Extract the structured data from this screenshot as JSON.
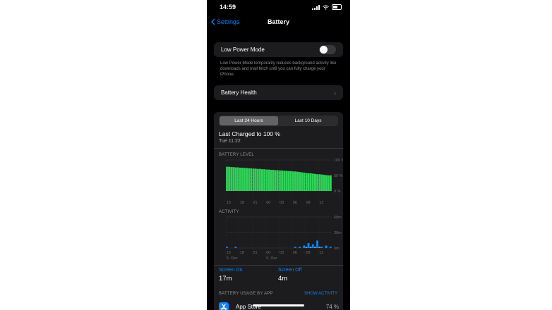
{
  "status_bar": {
    "time": "14:59"
  },
  "nav": {
    "back_label": "Settings",
    "title": "Battery"
  },
  "low_power": {
    "label": "Low Power Mode",
    "enabled": false,
    "description": "Low Power Mode temporarily reduces background activity like downloads and mail fetch until you can fully charge your iPhone."
  },
  "battery_health": {
    "label": "Battery Health"
  },
  "tabs": [
    {
      "label": "Last 24 Hours",
      "active": true
    },
    {
      "label": "Last 10 Days",
      "active": false
    }
  ],
  "last_charged": {
    "title": "Last Charged to 100 %",
    "time": "Tue 11:22"
  },
  "battery_level": {
    "heading": "BATTERY LEVEL",
    "y_ticks": [
      "100 %",
      "50 %",
      "0 %"
    ],
    "x_ticks": [
      "15",
      "18",
      "21",
      "00",
      "03",
      "06",
      "09",
      "12"
    ],
    "levels": [
      78,
      78,
      77,
      77,
      76,
      76,
      75,
      75,
      74,
      74,
      73,
      73,
      72,
      72,
      71,
      71,
      70,
      70,
      69,
      69,
      68,
      68,
      67,
      67,
      66,
      66,
      65,
      65,
      64,
      64,
      63,
      63,
      62,
      61,
      60,
      59,
      58,
      57,
      57,
      56,
      55,
      54,
      54,
      53,
      52,
      51,
      50,
      50
    ]
  },
  "activity": {
    "heading": "ACTIVITY",
    "y_ticks": [
      "60m",
      "30m",
      "0m"
    ],
    "x_ticks": [
      "15",
      "18",
      "21",
      "00",
      "03",
      "06",
      "09",
      "12"
    ],
    "date_labels": [
      "5. Dec",
      "6. Dec"
    ],
    "screen_on_minutes": [
      1,
      0,
      0,
      0,
      1,
      0,
      0,
      0,
      0,
      0,
      0,
      0,
      0,
      0,
      0,
      0,
      0,
      0,
      0,
      0,
      0,
      0,
      0,
      0,
      0,
      0,
      0,
      0,
      0,
      0,
      0,
      1,
      0,
      1,
      0,
      2,
      0,
      4,
      0,
      3,
      0,
      6,
      0,
      1,
      0,
      2,
      0,
      1
    ],
    "screen_off_minutes": [
      0,
      0,
      0,
      0,
      0,
      0,
      0,
      0,
      0,
      0,
      0,
      0,
      0,
      0,
      0,
      0,
      0,
      0,
      0,
      0,
      0,
      0,
      0,
      0,
      0,
      0,
      0,
      0,
      0,
      0,
      0,
      0,
      0,
      0,
      0,
      1,
      0,
      1,
      0,
      1,
      0,
      1,
      0,
      0,
      0,
      0,
      0,
      0
    ]
  },
  "screen_summary": [
    {
      "label": "Screen On",
      "value": "17m"
    },
    {
      "label": "Screen Off",
      "value": "4m"
    }
  ],
  "usage": {
    "heading": "BATTERY USAGE BY APP",
    "action": "SHOW ACTIVITY",
    "apps": [
      {
        "name": "App Store",
        "percent": "74 %",
        "icon": "app-store-icon"
      }
    ]
  },
  "colors": {
    "accent": "#0a84ff",
    "battery_fill": "#30d158",
    "card": "#1c1c1e"
  }
}
